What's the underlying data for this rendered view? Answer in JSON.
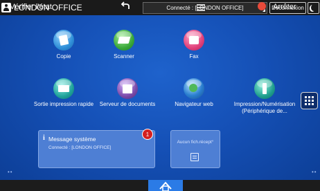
{
  "header": {
    "office_title": "LONDON OFFICE",
    "connection_status": "Connecté : [LONDON OFFICE]",
    "logout_label": "Déconnexion"
  },
  "apps": [
    {
      "label": "Copie",
      "icon": "copy-icon",
      "color": "#2f8fd8"
    },
    {
      "label": "Scanner",
      "icon": "scanner-icon",
      "color": "#3aa83a"
    },
    {
      "label": "Fax",
      "icon": "fax-icon",
      "color": "#e0407a"
    },
    {
      "label": "Sortie impression rapide",
      "icon": "quick-print-icon",
      "color": "#1fa29a"
    },
    {
      "label": "Serveur de documents",
      "icon": "document-server-icon",
      "color": "#7a4aa8"
    },
    {
      "label": "Navigateur web",
      "icon": "web-browser-icon",
      "color": "#2a7fd0"
    },
    {
      "label": "Impression/Numérisation (Périphérique de...",
      "icon": "usb-print-scan-icon",
      "color": "#1f9e8e"
    }
  ],
  "message_widget": {
    "info_glyph": "i",
    "title": "Message système",
    "body": "Connecté : [LONDON OFFICE]",
    "badge_count": "1"
  },
  "receipt_widget": {
    "text": "Aucun fich.récept°"
  },
  "bottom_bar": {
    "check_status_label": "Vérifier l'état",
    "stop_label": "Arrêter",
    "accent": "#2b7be6"
  }
}
